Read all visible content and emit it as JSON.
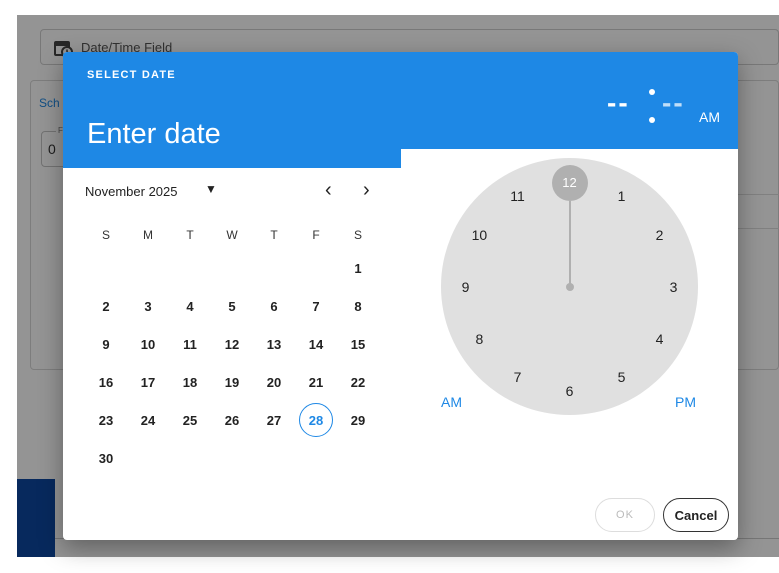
{
  "background": {
    "field_label": "Date/Time Field",
    "card_title": "Sch",
    "card_field_label": "Fr",
    "card_field_value": "0"
  },
  "dialog": {
    "header_label": "SELECT DATE",
    "header_value": "Enter date",
    "time": {
      "hours": "--",
      "minutes": "--",
      "period": "AM"
    },
    "calendar": {
      "month_label": "November 2025",
      "prev_icon": "‹",
      "next_icon": "›",
      "weekdays": [
        "S",
        "M",
        "T",
        "W",
        "T",
        "F",
        "S"
      ],
      "weeks": [
        [
          "",
          "",
          "",
          "",
          "",
          "",
          "1"
        ],
        [
          "2",
          "3",
          "4",
          "5",
          "6",
          "7",
          "8"
        ],
        [
          "9",
          "10",
          "11",
          "12",
          "13",
          "14",
          "15"
        ],
        [
          "16",
          "17",
          "18",
          "19",
          "20",
          "21",
          "22"
        ],
        [
          "23",
          "24",
          "25",
          "26",
          "27",
          "28",
          "29"
        ],
        [
          "30",
          "",
          "",
          "",
          "",
          "",
          ""
        ]
      ],
      "today": "28"
    },
    "clock": {
      "numbers": [
        "12",
        "1",
        "2",
        "3",
        "4",
        "5",
        "6",
        "7",
        "8",
        "9",
        "10",
        "11"
      ],
      "selected": "12",
      "am_label": "AM",
      "pm_label": "PM"
    },
    "buttons": {
      "ok": "OK",
      "cancel": "Cancel"
    }
  }
}
